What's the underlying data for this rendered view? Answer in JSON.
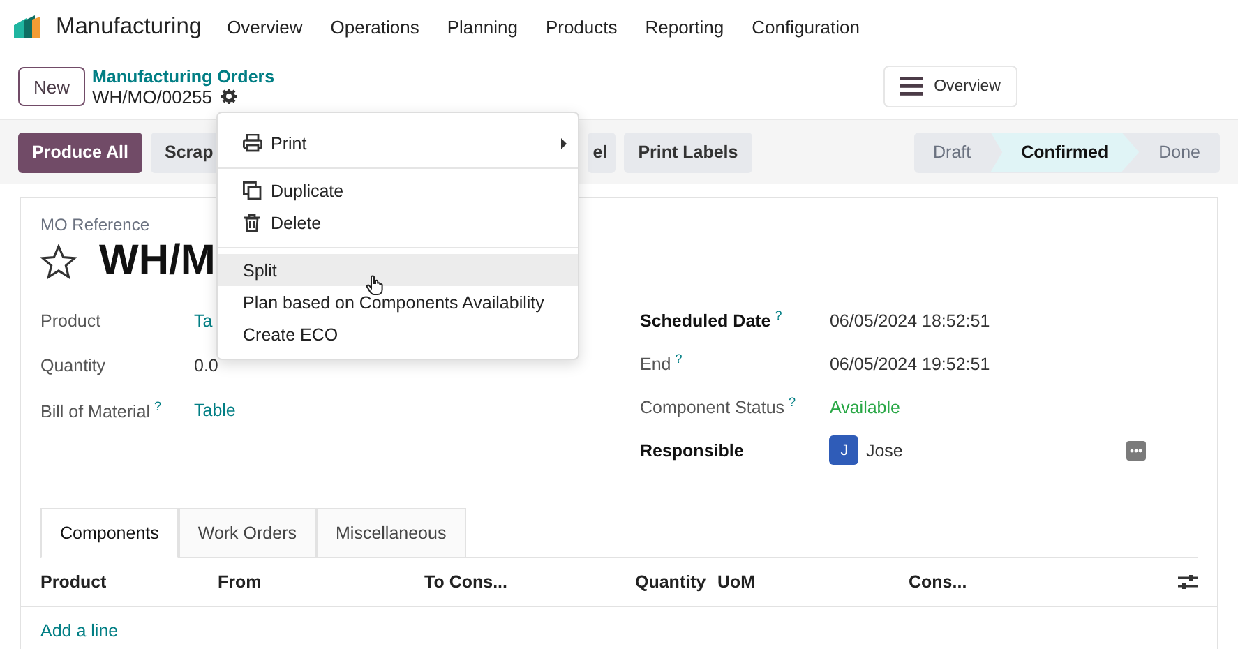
{
  "app": {
    "name": "Manufacturing"
  },
  "menu": [
    "Overview",
    "Operations",
    "Planning",
    "Products",
    "Reporting",
    "Configuration"
  ],
  "control_panel": {
    "new_button": "New",
    "breadcrumb": "Manufacturing Orders",
    "record": "WH/MO/00255",
    "view_button": "Overview"
  },
  "actions": [
    {
      "label": "Produce All",
      "kind": "primary"
    },
    {
      "label": "Scrap",
      "kind": "secondary"
    },
    {
      "label": "el",
      "kind": "secondary"
    },
    {
      "label": "Print Labels",
      "kind": "secondary"
    }
  ],
  "status_steps": [
    {
      "label": "Draft",
      "selected": false
    },
    {
      "label": "Confirmed",
      "selected": true
    },
    {
      "label": "Done",
      "selected": false
    }
  ],
  "gear_menu": {
    "groups": [
      [
        {
          "label": "Print",
          "kind": "print",
          "highlighted": false
        }
      ],
      [
        {
          "label": "Duplicate",
          "kind": "duplicate",
          "highlighted": false
        },
        {
          "label": "Delete",
          "kind": "delete",
          "highlighted": false
        }
      ],
      [
        {
          "label": "Split",
          "kind": "plain",
          "highlighted": true
        },
        {
          "label": "Plan based on Components Availability",
          "kind": "plain",
          "highlighted": false
        },
        {
          "label": "Create ECO",
          "kind": "plain",
          "highlighted": false
        }
      ]
    ]
  },
  "form": {
    "reference_label": "MO Reference",
    "title": "WH/M",
    "favorite": false,
    "fields_left": [
      {
        "label": "Product",
        "value": "Ta",
        "kind": "link",
        "required": false
      },
      {
        "label": "Quantity",
        "value": "0.0",
        "kind": "plain",
        "required": false
      },
      {
        "label": "Bill of Material",
        "help": "?",
        "value": "Table",
        "kind": "link",
        "required": false
      }
    ],
    "fields_right": [
      {
        "label": "Scheduled Date",
        "help": "?",
        "value": "06/05/2024 18:52:51",
        "kind": "plain",
        "required": true
      },
      {
        "label": "End",
        "help": "?",
        "value": "06/05/2024 19:52:51",
        "kind": "plain",
        "required": false
      },
      {
        "label": "Component Status",
        "help": "?",
        "value": "Available",
        "kind": "status",
        "required": false
      },
      {
        "label": "Responsible",
        "value": "Jose",
        "avatar": "J",
        "kind": "user",
        "required": true
      }
    ]
  },
  "tabs": [
    {
      "label": "Components",
      "selected": true
    },
    {
      "label": "Work Orders",
      "selected": false
    },
    {
      "label": "Miscellaneous",
      "selected": false
    }
  ],
  "table": {
    "columns": [
      "Product",
      "From",
      "To Cons...",
      "Quantity",
      "UoM",
      "Cons..."
    ],
    "add_line": "Add a line"
  }
}
